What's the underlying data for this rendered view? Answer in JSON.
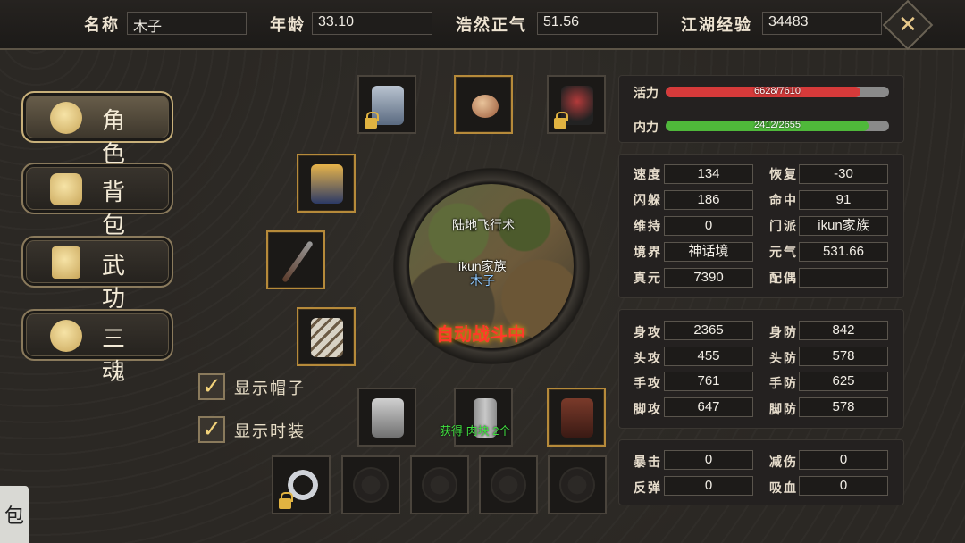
{
  "header": {
    "name_label": "名称",
    "name_value": "木子",
    "age_label": "年龄",
    "age_value": "33.10",
    "righteous_label": "浩然正气",
    "righteous_value": "51.56",
    "exp_label": "江湖经验",
    "exp_value": "34483",
    "close_icon": "✕"
  },
  "menu": [
    {
      "label": "角色",
      "icon": "character-icon",
      "active": true
    },
    {
      "label": "背包",
      "icon": "bag-icon",
      "active": false
    },
    {
      "label": "武功",
      "icon": "scroll-icon",
      "active": false
    },
    {
      "label": "三魂",
      "icon": "soul-icon",
      "active": false
    }
  ],
  "equipment": {
    "slots": [
      {
        "name": "robe-slot",
        "item": "robe-icon",
        "locked": true
      },
      {
        "name": "food-slot",
        "item": "bun-icon",
        "locked": false
      },
      {
        "name": "cape-slot",
        "item": "cape-icon",
        "locked": true
      },
      {
        "name": "armor-slot",
        "item": "armor-icon",
        "locked": false
      },
      {
        "name": "weapon-slot",
        "item": "staff-icon",
        "locked": false
      },
      {
        "name": "bracer-slot",
        "item": "bracer-icon",
        "locked": false
      },
      {
        "name": "chest-slot",
        "item": "chestplate-icon",
        "locked": false
      },
      {
        "name": "pants-slot",
        "item": "pants-icon",
        "locked": false
      },
      {
        "name": "boots-slot",
        "item": "boots-icon",
        "locked": false
      },
      {
        "name": "ring-slot",
        "item": "ring-icon",
        "locked": true
      },
      {
        "name": "empty-slot-1",
        "item": "empty-slot-icon",
        "locked": false
      },
      {
        "name": "empty-slot-2",
        "item": "empty-slot-icon",
        "locked": false
      },
      {
        "name": "empty-slot-3",
        "item": "empty-slot-icon",
        "locked": false
      },
      {
        "name": "empty-slot-4",
        "item": "empty-slot-icon",
        "locked": false
      }
    ]
  },
  "portrait": {
    "skill_text": "陆地飞行术",
    "guild_text": "ikun家族",
    "player_text": "木子",
    "auto_battle_text": "自动战斗中"
  },
  "options": {
    "show_hat_label": "显示帽子",
    "show_hat_checked": true,
    "show_fashion_label": "显示时装",
    "show_fashion_checked": true
  },
  "notification": "获得 肉块 2个",
  "vitals": {
    "hp_label": "活力",
    "hp_text": "6628/7610",
    "hp_fraction": 0.871,
    "hp_color": "#d63a3a",
    "mp_label": "内力",
    "mp_text": "2412/2655",
    "mp_fraction": 0.908,
    "mp_color": "#4fb83a"
  },
  "attributes": {
    "speed_label": "速度",
    "speed_value": "134",
    "recover_label": "恢复",
    "recover_value": "-30",
    "dodge_label": "闪躲",
    "dodge_value": "186",
    "hit_label": "命中",
    "hit_value": "91",
    "sustain_label": "维持",
    "sustain_value": "0",
    "sect_label": "门派",
    "sect_value": "ikun家族",
    "realm_label": "境界",
    "realm_value": "神话境",
    "yuanqi_label": "元气",
    "yuanqi_value": "531.66",
    "zhenyuan_label": "真元",
    "zhenyuan_value": "7390",
    "spouse_label": "配偶",
    "spouse_value": ""
  },
  "combat": {
    "body_atk_label": "身攻",
    "body_atk": "2365",
    "body_def_label": "身防",
    "body_def": "842",
    "head_atk_label": "头攻",
    "head_atk": "455",
    "head_def_label": "头防",
    "head_def": "578",
    "hand_atk_label": "手攻",
    "hand_atk": "761",
    "hand_def_label": "手防",
    "hand_def": "625",
    "foot_atk_label": "脚攻",
    "foot_atk": "647",
    "foot_def_label": "脚防",
    "foot_def": "578"
  },
  "extra": {
    "crit_label": "暴击",
    "crit": "0",
    "reduce_label": "减伤",
    "reduce": "0",
    "reflect_label": "反弹",
    "reflect": "0",
    "lifesteal_label": "吸血",
    "lifesteal": "0"
  },
  "side_tab": "包"
}
